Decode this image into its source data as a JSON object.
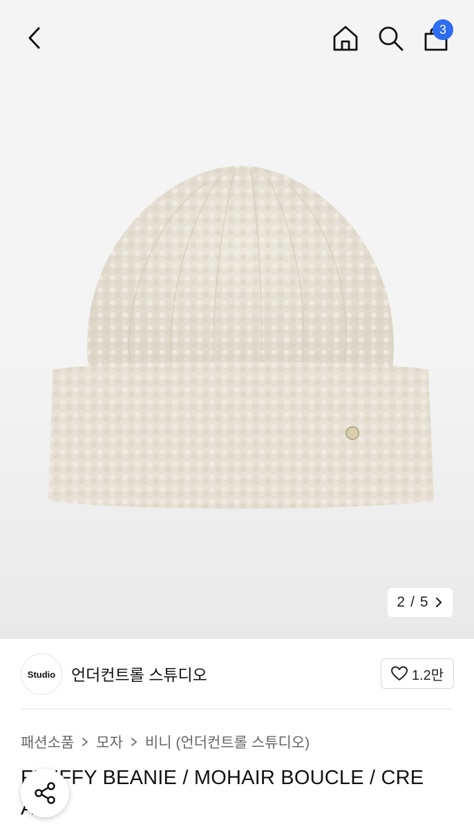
{
  "header": {
    "back_icon": "chevron-left-icon",
    "home_icon": "home-icon",
    "search_icon": "search-icon",
    "bag_icon": "shopping-bag-icon",
    "cart_count": "3",
    "badge_color": "#2d6cf3"
  },
  "gallery": {
    "current": "2",
    "separator": "/",
    "total": "5",
    "next_icon": "chevron-right-icon"
  },
  "store": {
    "logo_text": "Studio",
    "name": "언더컨트롤 스튜디오",
    "like_icon": "heart-icon",
    "like_count": "1.2만"
  },
  "breadcrumb": {
    "items": [
      "패션소품",
      "모자",
      "비니 (언더컨트롤 스튜디오)"
    ],
    "separator_icon": "chevron-right-icon"
  },
  "product": {
    "title_line1": "FLUFFY BEANIE / MOHAIR BOUCLE / CRE",
    "title_line2": "AM"
  },
  "share": {
    "icon": "share-icon"
  }
}
